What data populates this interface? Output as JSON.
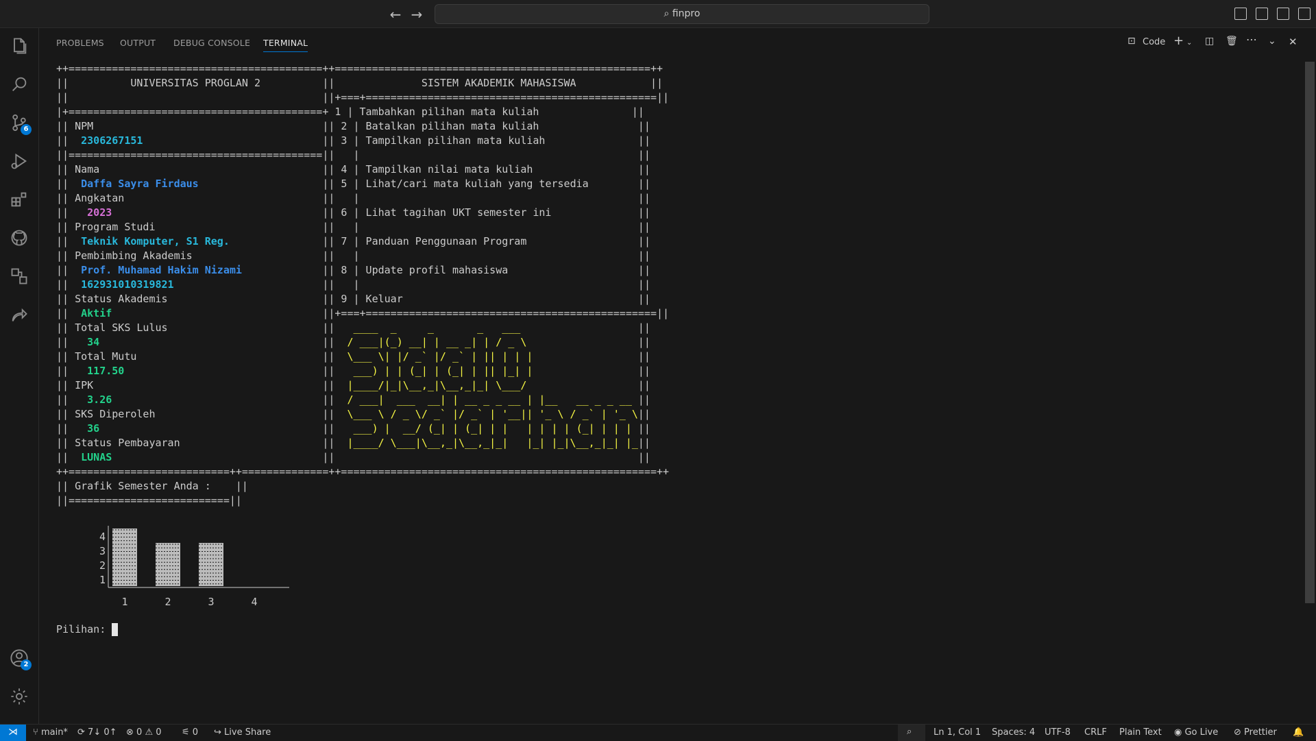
{
  "titlebar": {
    "search_text": "finpro",
    "back_icon": "arrow-left-icon",
    "forward_icon": "arrow-right-icon"
  },
  "activity_badges": {
    "source_control": "6",
    "accounts": "2"
  },
  "panel": {
    "tabs": [
      "PROBLEMS",
      "OUTPUT",
      "DEBUG CONSOLE",
      "TERMINAL"
    ],
    "active_tab": "TERMINAL",
    "terminal_name": "Code"
  },
  "terminal": {
    "border_top": "++=========================================++===================================================++",
    "left_title": "||          UNIVERSITAS PROGLAN 2          ||",
    "right_title": "              SISTEM AKADEMIK MAHASISWA            ||",
    "blank_left": "||                                         ||",
    "right_sep": "+===+===============================================||",
    "mid_sep": "|+=========================================+",
    "left_sep": "||=========================================||",
    "profile": [
      {
        "label": "NPM",
        "value": "2306267151",
        "color": "cyan",
        "indent": " "
      },
      {
        "label": "Nama",
        "value": "Daffa Sayra Firdaus",
        "color": "blue",
        "indent": " "
      },
      {
        "label": "Angkatan",
        "value": "2023",
        "color": "mag",
        "indent": "  "
      },
      {
        "label": "Program Studi",
        "value": "Teknik Komputer, S1 Reg.",
        "color": "cyan",
        "indent": " "
      },
      {
        "label": "Pembimbing Akademis",
        "value": "Prof. Muhamad Hakim Nizami",
        "color": "blue",
        "indent": " ",
        "extra": "162931010319821"
      },
      {
        "label": "Status Akademis",
        "value": "Aktif",
        "color": "green",
        "indent": " "
      },
      {
        "label": "Total SKS Lulus",
        "value": "34",
        "color": "green",
        "indent": "  "
      },
      {
        "label": "Total Mutu",
        "value": "117.50",
        "color": "green",
        "indent": "  "
      },
      {
        "label": "IPK",
        "value": "3.26",
        "color": "green",
        "indent": "  "
      },
      {
        "label": "SKS Diperoleh",
        "value": "36",
        "color": "green",
        "indent": "  "
      },
      {
        "label": "Status Pembayaran",
        "value": "LUNAS",
        "color": "green",
        "indent": " "
      }
    ],
    "menu": [
      {
        "no": "1",
        "text": "Tambahkan pilihan mata kuliah"
      },
      {
        "no": "2",
        "text": "Batalkan pilihan mata kuliah"
      },
      {
        "no": "3",
        "text": "Tampilkan pilihan mata kuliah"
      },
      {
        "no": "",
        "text": ""
      },
      {
        "no": "4",
        "text": "Tampilkan nilai mata kuliah"
      },
      {
        "no": "5",
        "text": "Lihat/cari mata kuliah yang tersedia"
      },
      {
        "no": "",
        "text": ""
      },
      {
        "no": "6",
        "text": "Lihat tagihan UKT semester ini"
      },
      {
        "no": "",
        "text": ""
      },
      {
        "no": "7",
        "text": "Panduan Penggunaan Program"
      },
      {
        "no": "",
        "text": ""
      },
      {
        "no": "8",
        "text": "Update profil mahasiswa"
      },
      {
        "no": "",
        "text": ""
      },
      {
        "no": "9",
        "text": "Keluar"
      }
    ],
    "ascii_art": [
      "  ____  _     _       _   ___             ",
      " / ___|(_) __| | __ _| | / _ \\            ",
      " \\___ \\| |/ _` |/ _` | || | | |           ",
      "  ___) | | (_| | (_| | || |_| |           ",
      " |____/|_|\\__,_|\\__,_|_| \\___/            ",
      " / ___|  ___  __| | __ _ _ __ | |__   __ _ _ __   __ _ ",
      " \\___ \\ / _ \\/ _` |/ _` | '__|| '_ \\ / _` | '_ \\ / _` |",
      "  ___) |  __/ (_| | (_| | |   | | | | (_| | | | | (_| |",
      " |____/ \\___|\\__,_|\\__,_|_|   |_| |_|\\__,_|_| |_|\\__,_|",
      ""
    ],
    "border_bottom": "++==========================++==============++===================================================++",
    "graph_title": "|| Grafik Semester Anda :    ||",
    "graph_sep": "||==========================||",
    "prompt": "Pilihan: "
  },
  "chart_data": {
    "type": "bar",
    "title": "Grafik Semester Anda :",
    "categories": [
      "1",
      "2",
      "3",
      "4"
    ],
    "values": [
      4,
      3,
      3,
      0
    ],
    "ylim": [
      0,
      4
    ],
    "y_ticks": [
      "4",
      "3",
      "2",
      "1"
    ],
    "bar_color": "#d9d9d9"
  },
  "statusbar": {
    "branch": "main*",
    "sync": "7↓ 0↑",
    "errors": "0",
    "warnings": "0",
    "ports": "0",
    "live_share": "Live Share",
    "position": "Ln 1, Col 1",
    "spaces": "Spaces: 4",
    "encoding": "UTF-8",
    "eol": "CRLF",
    "language": "Plain Text",
    "go_live": "Go Live",
    "prettier": "Prettier"
  }
}
